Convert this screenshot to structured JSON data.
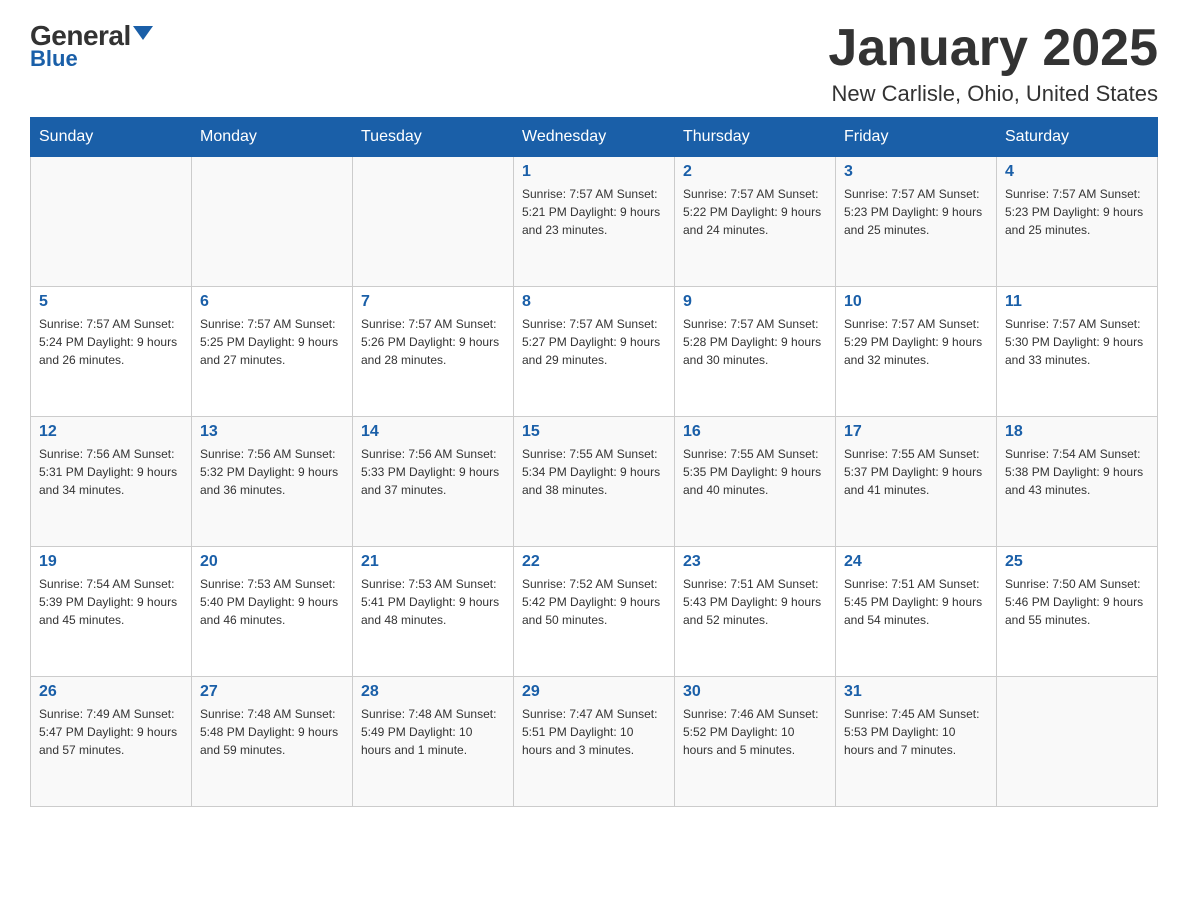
{
  "header": {
    "logo_general": "General",
    "logo_blue": "Blue",
    "title": "January 2025",
    "subtitle": "New Carlisle, Ohio, United States"
  },
  "days_of_week": [
    "Sunday",
    "Monday",
    "Tuesday",
    "Wednesday",
    "Thursday",
    "Friday",
    "Saturday"
  ],
  "weeks": [
    [
      {
        "day": "",
        "info": ""
      },
      {
        "day": "",
        "info": ""
      },
      {
        "day": "",
        "info": ""
      },
      {
        "day": "1",
        "info": "Sunrise: 7:57 AM\nSunset: 5:21 PM\nDaylight: 9 hours\nand 23 minutes."
      },
      {
        "day": "2",
        "info": "Sunrise: 7:57 AM\nSunset: 5:22 PM\nDaylight: 9 hours\nand 24 minutes."
      },
      {
        "day": "3",
        "info": "Sunrise: 7:57 AM\nSunset: 5:23 PM\nDaylight: 9 hours\nand 25 minutes."
      },
      {
        "day": "4",
        "info": "Sunrise: 7:57 AM\nSunset: 5:23 PM\nDaylight: 9 hours\nand 25 minutes."
      }
    ],
    [
      {
        "day": "5",
        "info": "Sunrise: 7:57 AM\nSunset: 5:24 PM\nDaylight: 9 hours\nand 26 minutes."
      },
      {
        "day": "6",
        "info": "Sunrise: 7:57 AM\nSunset: 5:25 PM\nDaylight: 9 hours\nand 27 minutes."
      },
      {
        "day": "7",
        "info": "Sunrise: 7:57 AM\nSunset: 5:26 PM\nDaylight: 9 hours\nand 28 minutes."
      },
      {
        "day": "8",
        "info": "Sunrise: 7:57 AM\nSunset: 5:27 PM\nDaylight: 9 hours\nand 29 minutes."
      },
      {
        "day": "9",
        "info": "Sunrise: 7:57 AM\nSunset: 5:28 PM\nDaylight: 9 hours\nand 30 minutes."
      },
      {
        "day": "10",
        "info": "Sunrise: 7:57 AM\nSunset: 5:29 PM\nDaylight: 9 hours\nand 32 minutes."
      },
      {
        "day": "11",
        "info": "Sunrise: 7:57 AM\nSunset: 5:30 PM\nDaylight: 9 hours\nand 33 minutes."
      }
    ],
    [
      {
        "day": "12",
        "info": "Sunrise: 7:56 AM\nSunset: 5:31 PM\nDaylight: 9 hours\nand 34 minutes."
      },
      {
        "day": "13",
        "info": "Sunrise: 7:56 AM\nSunset: 5:32 PM\nDaylight: 9 hours\nand 36 minutes."
      },
      {
        "day": "14",
        "info": "Sunrise: 7:56 AM\nSunset: 5:33 PM\nDaylight: 9 hours\nand 37 minutes."
      },
      {
        "day": "15",
        "info": "Sunrise: 7:55 AM\nSunset: 5:34 PM\nDaylight: 9 hours\nand 38 minutes."
      },
      {
        "day": "16",
        "info": "Sunrise: 7:55 AM\nSunset: 5:35 PM\nDaylight: 9 hours\nand 40 minutes."
      },
      {
        "day": "17",
        "info": "Sunrise: 7:55 AM\nSunset: 5:37 PM\nDaylight: 9 hours\nand 41 minutes."
      },
      {
        "day": "18",
        "info": "Sunrise: 7:54 AM\nSunset: 5:38 PM\nDaylight: 9 hours\nand 43 minutes."
      }
    ],
    [
      {
        "day": "19",
        "info": "Sunrise: 7:54 AM\nSunset: 5:39 PM\nDaylight: 9 hours\nand 45 minutes."
      },
      {
        "day": "20",
        "info": "Sunrise: 7:53 AM\nSunset: 5:40 PM\nDaylight: 9 hours\nand 46 minutes."
      },
      {
        "day": "21",
        "info": "Sunrise: 7:53 AM\nSunset: 5:41 PM\nDaylight: 9 hours\nand 48 minutes."
      },
      {
        "day": "22",
        "info": "Sunrise: 7:52 AM\nSunset: 5:42 PM\nDaylight: 9 hours\nand 50 minutes."
      },
      {
        "day": "23",
        "info": "Sunrise: 7:51 AM\nSunset: 5:43 PM\nDaylight: 9 hours\nand 52 minutes."
      },
      {
        "day": "24",
        "info": "Sunrise: 7:51 AM\nSunset: 5:45 PM\nDaylight: 9 hours\nand 54 minutes."
      },
      {
        "day": "25",
        "info": "Sunrise: 7:50 AM\nSunset: 5:46 PM\nDaylight: 9 hours\nand 55 minutes."
      }
    ],
    [
      {
        "day": "26",
        "info": "Sunrise: 7:49 AM\nSunset: 5:47 PM\nDaylight: 9 hours\nand 57 minutes."
      },
      {
        "day": "27",
        "info": "Sunrise: 7:48 AM\nSunset: 5:48 PM\nDaylight: 9 hours\nand 59 minutes."
      },
      {
        "day": "28",
        "info": "Sunrise: 7:48 AM\nSunset: 5:49 PM\nDaylight: 10 hours\nand 1 minute."
      },
      {
        "day": "29",
        "info": "Sunrise: 7:47 AM\nSunset: 5:51 PM\nDaylight: 10 hours\nand 3 minutes."
      },
      {
        "day": "30",
        "info": "Sunrise: 7:46 AM\nSunset: 5:52 PM\nDaylight: 10 hours\nand 5 minutes."
      },
      {
        "day": "31",
        "info": "Sunrise: 7:45 AM\nSunset: 5:53 PM\nDaylight: 10 hours\nand 7 minutes."
      },
      {
        "day": "",
        "info": ""
      }
    ]
  ]
}
